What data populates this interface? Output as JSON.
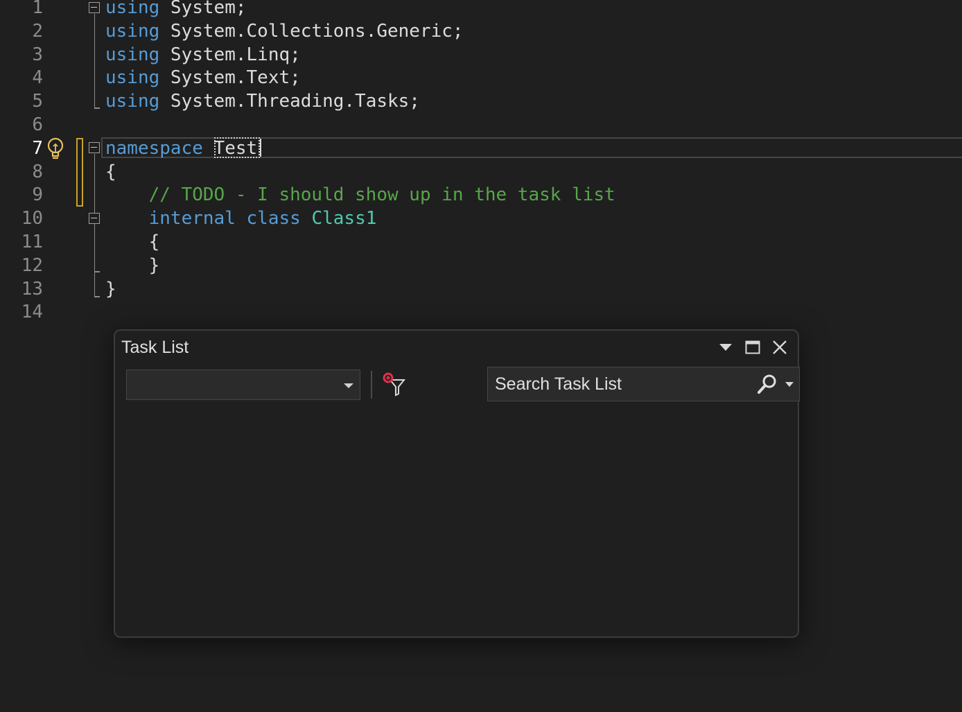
{
  "editor": {
    "current_line": 7,
    "lines": [
      {
        "num": "1",
        "tokens": [
          {
            "t": "using",
            "c": "kw"
          },
          {
            "t": " System;",
            "c": "plain"
          }
        ]
      },
      {
        "num": "2",
        "tokens": [
          {
            "t": "using",
            "c": "kw"
          },
          {
            "t": " System.Collections.Generic;",
            "c": "plain"
          }
        ]
      },
      {
        "num": "3",
        "tokens": [
          {
            "t": "using",
            "c": "kw"
          },
          {
            "t": " System.Linq;",
            "c": "plain"
          }
        ]
      },
      {
        "num": "4",
        "tokens": [
          {
            "t": "using",
            "c": "kw"
          },
          {
            "t": " System.Text;",
            "c": "plain"
          }
        ]
      },
      {
        "num": "5",
        "tokens": [
          {
            "t": "using",
            "c": "kw"
          },
          {
            "t": " System.Threading.Tasks;",
            "c": "plain"
          }
        ]
      },
      {
        "num": "6",
        "tokens": []
      },
      {
        "num": "7",
        "tokens": [
          {
            "t": "namespace",
            "c": "kw"
          },
          {
            "t": " Test",
            "c": "plain"
          }
        ]
      },
      {
        "num": "8",
        "tokens": [
          {
            "t": "{",
            "c": "plain"
          }
        ]
      },
      {
        "num": "9",
        "tokens": [
          {
            "t": "    // TODO - I should show up in the task list",
            "c": "cmt"
          }
        ]
      },
      {
        "num": "10",
        "tokens": [
          {
            "t": "    ",
            "c": "plain"
          },
          {
            "t": "internal",
            "c": "kw"
          },
          {
            "t": " ",
            "c": "plain"
          },
          {
            "t": "class",
            "c": "kw"
          },
          {
            "t": " ",
            "c": "plain"
          },
          {
            "t": "Class1",
            "c": "cls"
          }
        ]
      },
      {
        "num": "11",
        "tokens": [
          {
            "t": "    {",
            "c": "plain"
          }
        ]
      },
      {
        "num": "12",
        "tokens": [
          {
            "t": "    }",
            "c": "plain"
          }
        ]
      },
      {
        "num": "13",
        "tokens": [
          {
            "t": "}",
            "c": "plain"
          }
        ]
      },
      {
        "num": "14",
        "tokens": []
      }
    ]
  },
  "task_list": {
    "title": "Task List",
    "scope_dropdown_value": "",
    "search_placeholder": "Search Task List",
    "icons": {
      "window_position": "chevron-down-icon",
      "maximize": "maximize-icon",
      "close": "close-icon",
      "filter": "clear-filter-icon",
      "search": "search-icon",
      "search_options": "chevron-down-icon"
    }
  },
  "colors": {
    "background": "#1f1f1f",
    "keyword": "#569cd6",
    "type": "#4ec9b0",
    "comment": "#57a64a",
    "text": "#dcdcdc",
    "line_number": "#8c8c8c",
    "change_marker": "#c9a227",
    "filter_badge": "#e0304a"
  }
}
